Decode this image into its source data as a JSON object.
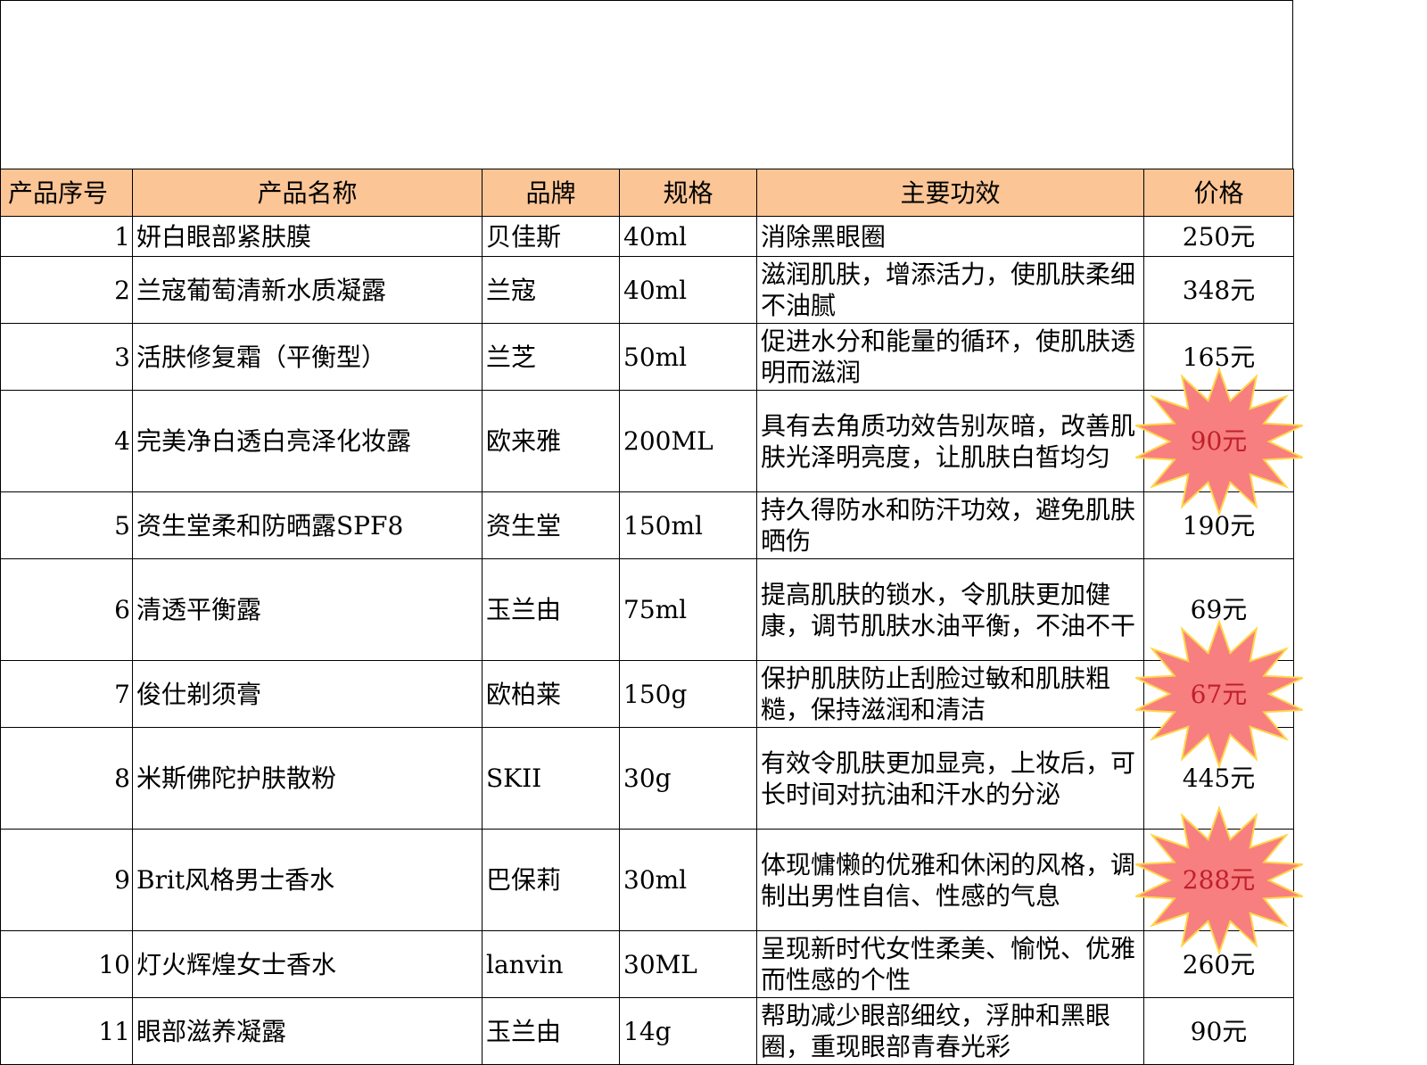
{
  "table": {
    "headers": [
      "产品序号",
      "产品名称",
      "品牌",
      "规格",
      "主要功效",
      "价格"
    ],
    "rows": [
      {
        "idx": "1",
        "name": "妍白眼部紧肤膜",
        "brand": "贝佳斯",
        "spec": "40ml",
        "effect": "消除黑眼圈",
        "price": "250元",
        "highlight": false
      },
      {
        "idx": "2",
        "name": "兰寇葡萄清新水质凝露",
        "brand": "兰寇",
        "spec": "40ml",
        "effect": "滋润肌肤，增添活力，使肌肤柔细不油腻",
        "price": "348元",
        "highlight": false
      },
      {
        "idx": "3",
        "name": "活肤修复霜（平衡型）",
        "brand": "兰芝",
        "spec": "50ml",
        "effect": "促进水分和能量的循环，使肌肤透明而滋润",
        "price": "165元",
        "highlight": false
      },
      {
        "idx": "4",
        "name": "完美净白透白亮泽化妆露",
        "brand": "欧来雅",
        "spec": "200ML",
        "effect": "具有去角质功效告别灰暗，改善肌肤光泽明亮度，让肌肤白皙均匀",
        "price": "90元",
        "highlight": true
      },
      {
        "idx": "5",
        "name": "资生堂柔和防晒露SPF8",
        "brand": "资生堂",
        "spec": "150ml",
        "effect": "持久得防水和防汗功效，避免肌肤晒伤",
        "price": "190元",
        "highlight": false
      },
      {
        "idx": "6",
        "name": "清透平衡露",
        "brand": "玉兰由",
        "spec": "75ml",
        "effect": "提高肌肤的锁水，令肌肤更加健康，调节肌肤水油平衡，不油不干",
        "price": "69元",
        "highlight": false
      },
      {
        "idx": "7",
        "name": "俊仕剃须膏",
        "brand": "欧柏莱",
        "spec": "150g",
        "effect": "保护肌肤防止刮脸过敏和肌肤粗糙，保持滋润和清洁",
        "price": "67元",
        "highlight": true
      },
      {
        "idx": "8",
        "name": "米斯佛陀护肤散粉",
        "brand": "SKII",
        "spec": "30g",
        "effect": "有效令肌肤更加显亮，上妆后，可长时间对抗油和汗水的分泌",
        "price": "445元",
        "highlight": false
      },
      {
        "idx": "9",
        "name": "Brit风格男士香水",
        "brand": "巴保莉",
        "spec": "30ml",
        "effect": "体现慵懒的优雅和休闲的风格，调制出男性自信、性感的气息",
        "price": "288元",
        "highlight": true
      },
      {
        "idx": "10",
        "name": "灯火辉煌女士香水",
        "brand": "lanvin",
        "spec": "30ML",
        "effect": "呈现新时代女性柔美、愉悦、优雅而性感的个性",
        "price": "260元",
        "highlight": false
      },
      {
        "idx": "11",
        "name": "眼部滋养凝露",
        "brand": "玉兰由",
        "spec": "14g",
        "effect": "帮助减少眼部细纹，浮肿和黑眼圈，重现眼部青春光彩",
        "price": "90元",
        "highlight": false
      }
    ]
  },
  "colors": {
    "header_bg": "#fbc596",
    "burst_fill": "#f77f7f",
    "burst_stroke": "#ffd54a",
    "price_highlight": "#c0202a"
  }
}
